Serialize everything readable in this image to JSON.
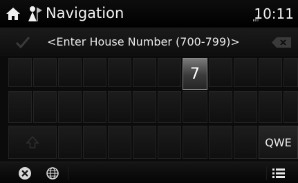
{
  "header": {
    "title": "Navigation",
    "time": "10:11",
    "icons": [
      "home-icon",
      "navigation-icon",
      "signal-icon"
    ]
  },
  "input": {
    "placeholder": "<Enter House Number (700-799)>",
    "ok_icon": "checkmark-icon",
    "backspace_icon": "backspace-icon"
  },
  "keyboard": {
    "active_key": "7",
    "mode_key_label": "QWE",
    "shift_icon": "shift-icon"
  },
  "bottom_bar": {
    "icons": [
      "voice-icon",
      "globe-icon",
      "menu-icon"
    ]
  },
  "colors": {
    "active_key": "#4a4a4a",
    "text": "#ffffff",
    "background": "#000000"
  }
}
